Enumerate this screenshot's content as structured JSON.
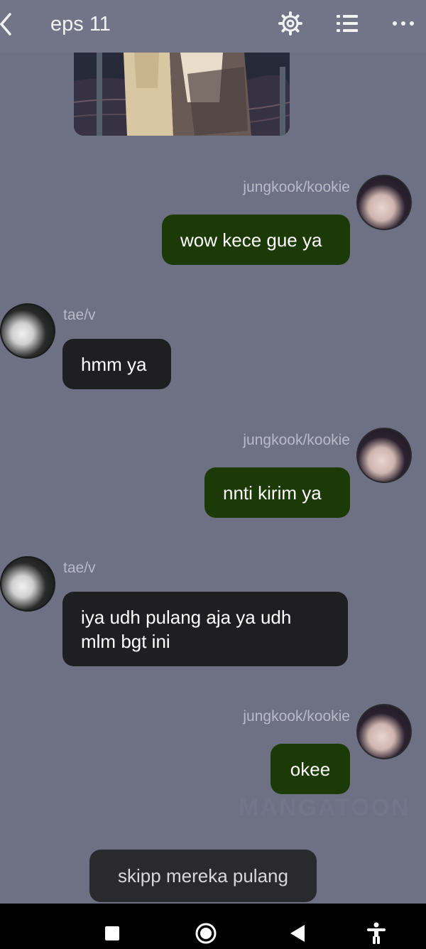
{
  "header": {
    "title": "eps 11"
  },
  "messages": [
    {
      "sender": "jungkook/kookie",
      "text": "wow kece gue ya",
      "side": "right"
    },
    {
      "sender": "tae/v",
      "text": "hmm ya",
      "side": "left"
    },
    {
      "sender": "jungkook/kookie",
      "text": "nnti kirim ya",
      "side": "right"
    },
    {
      "sender": "tae/v",
      "text": "iya udh pulang aja ya udh mlm bgt ini",
      "side": "left"
    },
    {
      "sender": "jungkook/kookie",
      "text": "okee",
      "side": "right"
    }
  ],
  "watermark": "MANGATOON",
  "skip_button": "skipp mereka pulang",
  "colors": {
    "background": "#6e7083",
    "topbar": "#727488",
    "my_bubble": "#1c3a07",
    "their_bubble": "#1f1f21",
    "skip_button": "#2a2a2e"
  },
  "icons": {
    "back": "chevron-left-icon",
    "settings": "gear-icon",
    "list": "list-icon",
    "more": "more-horizontal-icon",
    "nav_recents": "square-icon",
    "nav_home": "circle-icon",
    "nav_back": "triangle-back-icon",
    "nav_accessibility": "accessibility-icon"
  }
}
